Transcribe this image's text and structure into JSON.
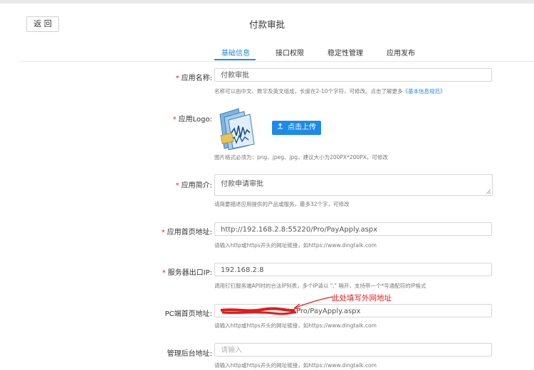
{
  "header": {
    "back_label": "返 回",
    "title": "付款审批"
  },
  "tabs": [
    {
      "label": "基础信息",
      "active": true
    },
    {
      "label": "接口权限",
      "active": false
    },
    {
      "label": "稳定性管理",
      "active": false
    },
    {
      "label": "应用发布",
      "active": false
    }
  ],
  "form": {
    "required_mark": "*",
    "app_name": {
      "label": "应用名称:",
      "value": "付款审批",
      "hint": "名称可以由中文、数字及英文组成，长度在2-10个字符，可修改。点击了解更多",
      "hint_link": "《基本信息规范》"
    },
    "app_logo": {
      "label": "应用Logo:",
      "upload_label": "点击上传",
      "hint": "图片格式必须为：png、jpeg、jpg，建议大小为200PX*200PX，可修改"
    },
    "app_intro": {
      "label": "应用简介:",
      "value": "付款申请审批",
      "hint": "请简要描述应用提供的产品或服务，最多32个字，可修改"
    },
    "home_url": {
      "label": "应用首页地址:",
      "value": "http://192.168.2.8:55220/Pro/PayApply.aspx",
      "hint": "请输入http或https开头的网址链接，如https://www.dingtalk.com"
    },
    "server_ip": {
      "label": "服务器出口IP:",
      "value": "192.168.2.8",
      "hint": "调用钉钉服务端API时的合法IP列表，多个IP请以 \",\" 隔开，支持带一个*号通配符的IP格式"
    },
    "pc_home_url": {
      "label": "PC端首页地址:",
      "value_visible": "Pro/PayApply.aspx",
      "hint": "请输入http或https开头的网址链接，如https://www.dingtalk.com",
      "annotation": "此处填写外网地址"
    },
    "admin_url": {
      "label": "管理后台地址:",
      "placeholder": "请输入",
      "hint": "请输入http或https开头的网址链接，如https://www.dingtalk.com"
    }
  },
  "colors": {
    "primary": "#1e8ae8",
    "required": "#f5222d",
    "annotation": "#f01d1d"
  }
}
